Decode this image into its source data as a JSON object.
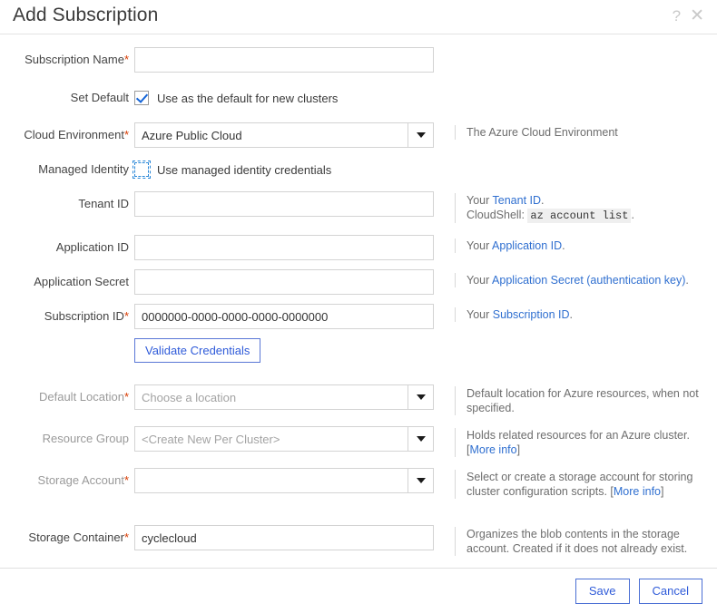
{
  "header": {
    "title": "Add Subscription",
    "help_icon": "question-mark-icon",
    "close_icon": "close-icon"
  },
  "form": {
    "subscription_name": {
      "label": "Subscription Name",
      "required": true,
      "value": "",
      "placeholder": ""
    },
    "set_default": {
      "label": "Set Default",
      "checkbox_label": "Use as the default for new clusters",
      "checked": true
    },
    "cloud_environment": {
      "label": "Cloud Environment",
      "required": true,
      "value": "Azure Public Cloud",
      "help": "The Azure Cloud Environment"
    },
    "managed_identity": {
      "label": "Managed Identity",
      "checkbox_label": "Use managed identity credentials",
      "checked": false,
      "focused": true
    },
    "tenant_id": {
      "label": "Tenant ID",
      "required": false,
      "value": "",
      "help_prefix": "Your ",
      "help_link": "Tenant ID",
      "help_suffix": ".",
      "help_line2_prefix": "CloudShell: ",
      "help_code": "az account list",
      "help_line2_suffix": "."
    },
    "application_id": {
      "label": "Application ID",
      "value": "",
      "help_prefix": "Your ",
      "help_link": "Application ID",
      "help_suffix": "."
    },
    "application_secret": {
      "label": "Application Secret",
      "value": "",
      "help_prefix": "Your ",
      "help_link": "Application Secret (authentication key)",
      "help_suffix": "."
    },
    "subscription_id": {
      "label": "Subscription ID",
      "required": true,
      "value": "0000000-0000-0000-0000-0000000",
      "help_prefix": "Your ",
      "help_link": "Subscription ID",
      "help_suffix": "."
    },
    "validate_button": {
      "label": "Validate Credentials"
    },
    "default_location": {
      "label": "Default Location",
      "required": true,
      "value": "Choose a location",
      "is_placeholder": true,
      "disabled": true,
      "help": "Default location for Azure resources, when not specified."
    },
    "resource_group": {
      "label": "Resource Group",
      "required": false,
      "value": "<Create New Per Cluster>",
      "is_placeholder": true,
      "disabled": true,
      "help": "Holds related resources for an Azure cluster. ",
      "help_bracket_open": "[",
      "help_link": "More info",
      "help_bracket_close": "]"
    },
    "storage_account": {
      "label": "Storage Account",
      "required": true,
      "value": "",
      "is_placeholder": true,
      "disabled": true,
      "help": "Select or create a storage account for storing cluster configuration scripts. ",
      "help_bracket_open": "[",
      "help_link": "More info",
      "help_bracket_close": "]"
    },
    "storage_container": {
      "label": "Storage Container",
      "required": true,
      "value": "cyclecloud",
      "help": "Organizes the blob contents in the storage account. Created if it does not already exist."
    }
  },
  "footer": {
    "save_label": "Save",
    "cancel_label": "Cancel"
  },
  "colors": {
    "link": "#2f6fd0",
    "required_asterisk": "#d83b01",
    "accent_button": "#2f5bd9",
    "checkbox_check": "#1565d8"
  }
}
